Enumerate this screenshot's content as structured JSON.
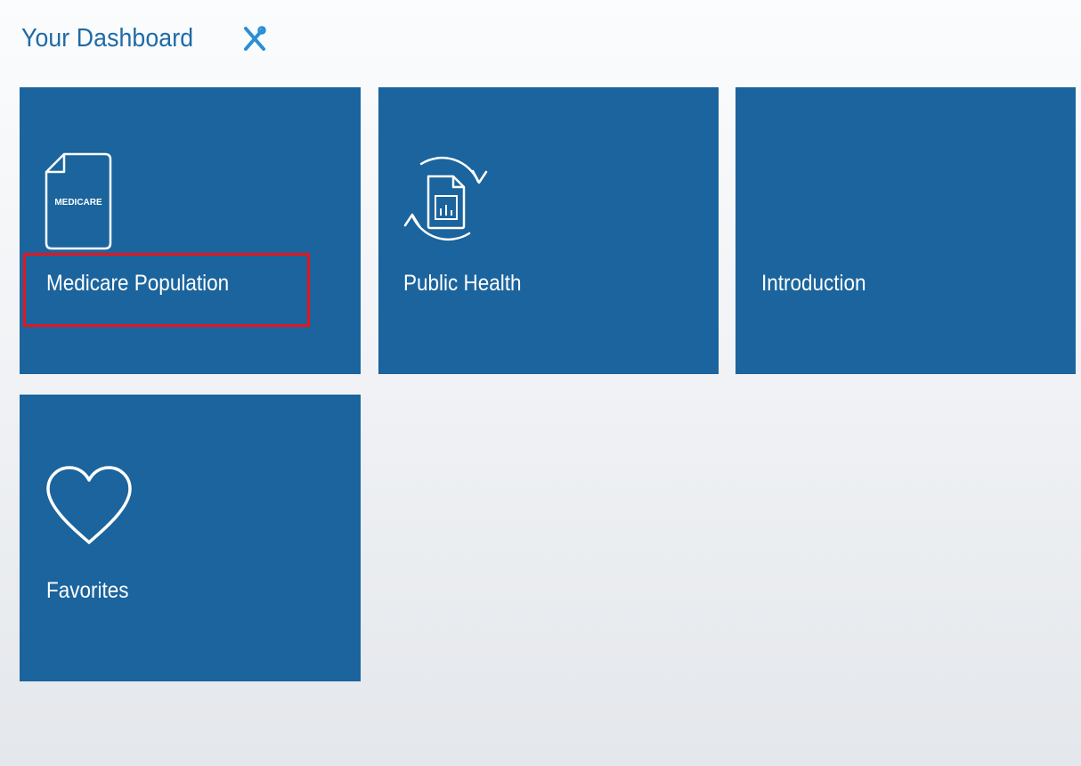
{
  "header": {
    "title": "Your Dashboard",
    "settings_icon": "tools-cross-icon"
  },
  "colors": {
    "accent": "#1e6aa6",
    "tile": "#1b649d",
    "highlight": "#e8141b"
  },
  "tiles": [
    {
      "label": "Medicare Population",
      "icon": "medicare-document-icon",
      "icon_text": "MEDICARE",
      "highlighted": true
    },
    {
      "label": "Public Health",
      "icon": "report-refresh-icon",
      "highlighted": false
    },
    {
      "label": "Introduction",
      "icon": "",
      "highlighted": false
    },
    {
      "label": "Favorites",
      "icon": "heart-icon",
      "highlighted": false
    }
  ]
}
